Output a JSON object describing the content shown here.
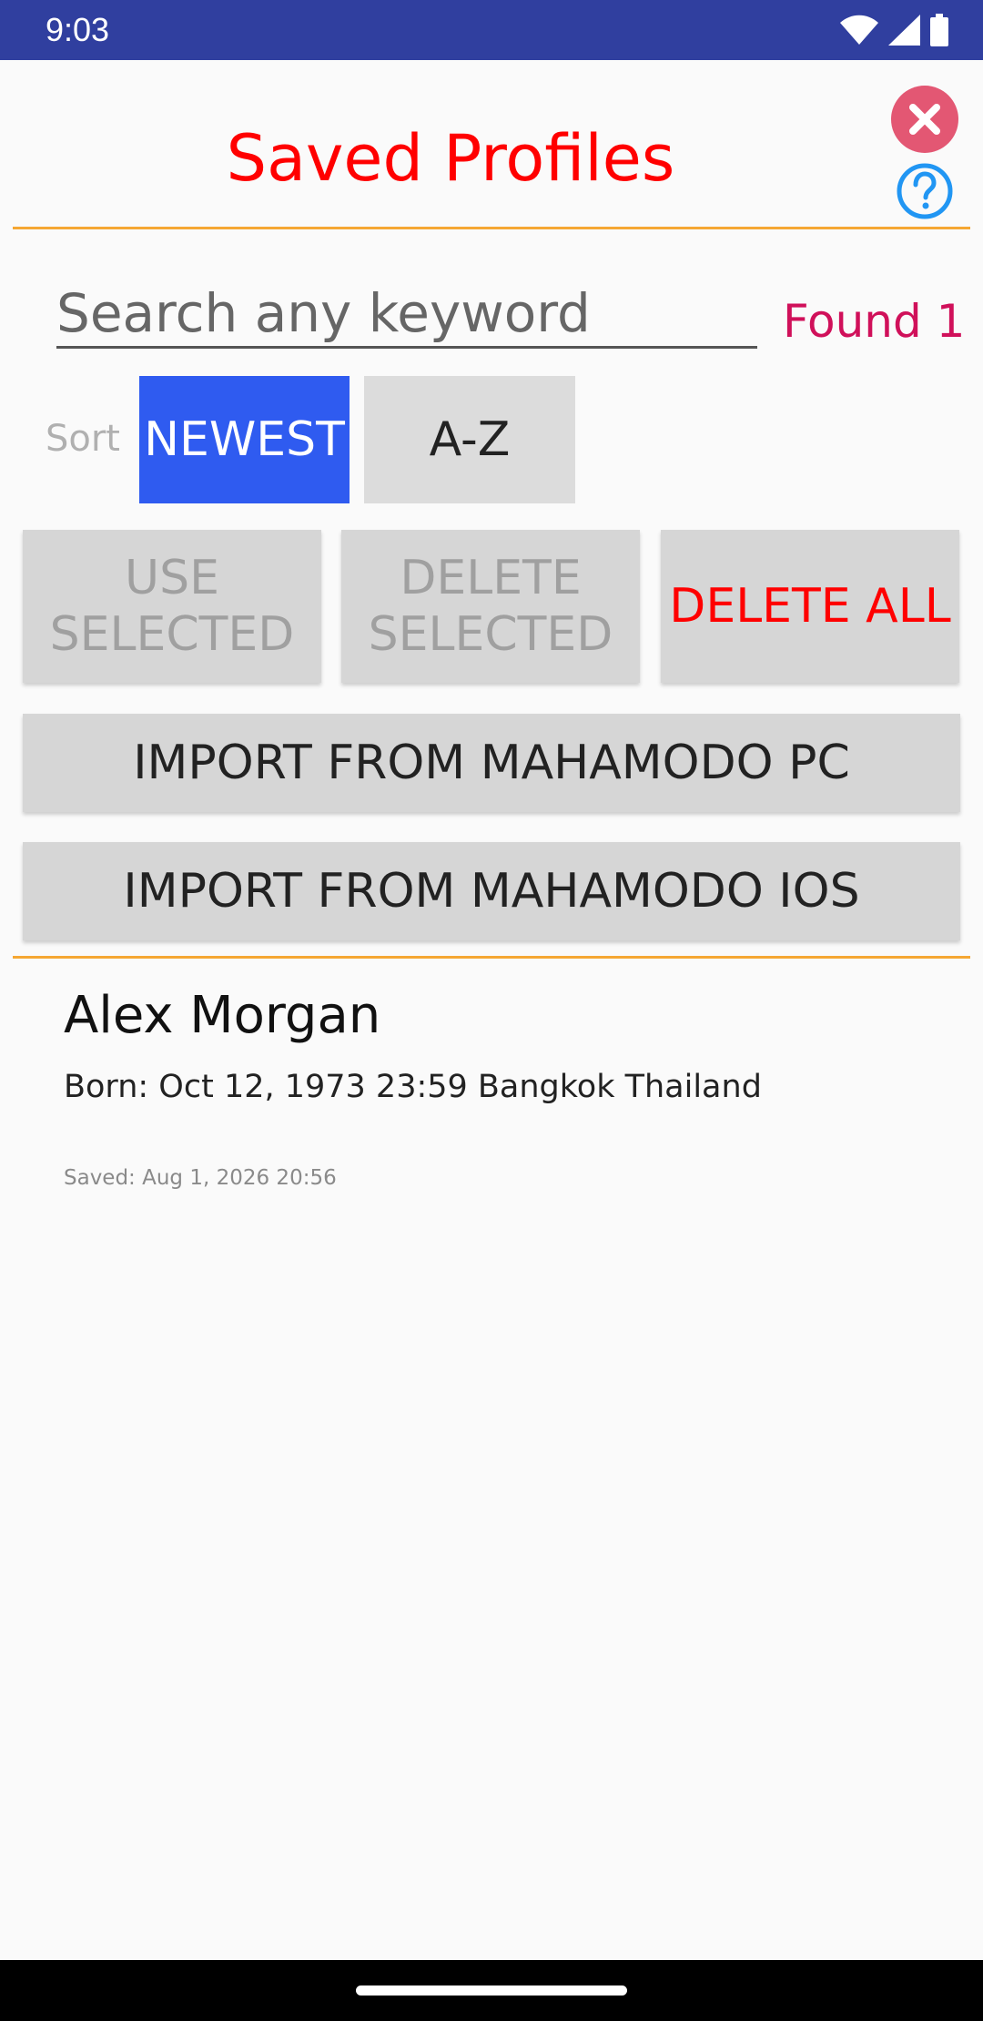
{
  "status_bar": {
    "time": "9:03",
    "icons": [
      "wifi-icon",
      "signal-icon",
      "battery-icon"
    ]
  },
  "header": {
    "title": "Saved Profiles",
    "close_icon": "close-icon",
    "help_icon": "help-icon"
  },
  "search": {
    "placeholder": "Search any keyword",
    "value": "",
    "found_text": "Found 1"
  },
  "sort": {
    "label": "Sort",
    "options": [
      "NEWEST",
      "A-Z"
    ],
    "selected": "NEWEST"
  },
  "actions": {
    "use_selected": "USE SELECTED",
    "delete_selected": "DELETE SELECTED",
    "delete_all": "DELETE ALL",
    "import_pc": "IMPORT FROM MAHAMODO PC",
    "import_ios": "IMPORT FROM MAHAMODO IOS"
  },
  "profiles": [
    {
      "name": "Alex Morgan",
      "born": "Born: Oct 12, 1973 23:59 Bangkok Thailand",
      "saved": "Saved: Aug 1, 2026 20:56"
    }
  ],
  "colors": {
    "status_bar": "#303f9f",
    "title": "#ff0000",
    "divider": "#f5a733",
    "found": "#d0105a",
    "sort_selected": "#2f5bf0",
    "close_button": "#e35773",
    "help_icon": "#2196f3",
    "delete_all": "#ff0000"
  }
}
